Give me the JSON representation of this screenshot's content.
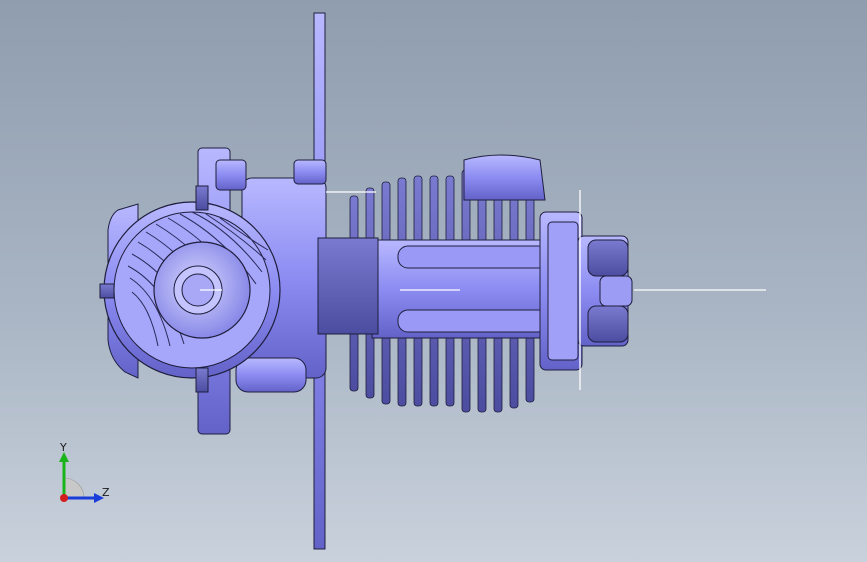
{
  "viewport": {
    "background_top": "#8f9daf",
    "background_bottom": "#c9d1dc",
    "model_color": "#8c8cf2",
    "edge_color": "#1e1e3c"
  },
  "triad": {
    "y_label": "Y",
    "z_label": "Z",
    "y_color": "#19b419",
    "z_color": "#1a3cd9",
    "x_color": "#d21e1e"
  }
}
